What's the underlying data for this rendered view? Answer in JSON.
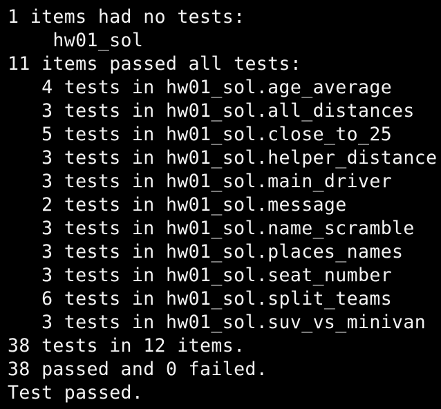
{
  "terminal": {
    "lines": [
      "1 items had no tests:",
      "    hw01_sol",
      "11 items passed all tests:",
      "   4 tests in hw01_sol.age_average",
      "   3 tests in hw01_sol.all_distances",
      "   5 tests in hw01_sol.close_to_25",
      "   3 tests in hw01_sol.helper_distance",
      "   3 tests in hw01_sol.main_driver",
      "   2 tests in hw01_sol.message",
      "   3 tests in hw01_sol.name_scramble",
      "   3 tests in hw01_sol.places_names",
      "   3 tests in hw01_sol.seat_number",
      "   6 tests in hw01_sol.split_teams",
      "   3 tests in hw01_sol.suv_vs_minivan",
      "38 tests in 12 items.",
      "38 passed and 0 failed.",
      "Test passed."
    ]
  },
  "colors": {
    "background": "#000000",
    "text": "#f2f2f2"
  }
}
